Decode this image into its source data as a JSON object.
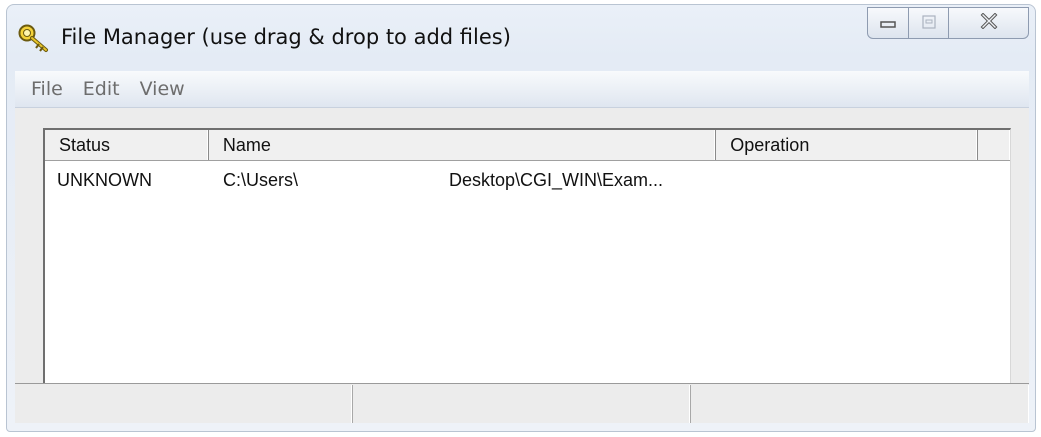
{
  "window": {
    "title": "File Manager (use drag & drop to add files)",
    "app_icon": "key-magnifier-icon",
    "controls": {
      "minimize": "minimize-icon",
      "maximize": "maximize-icon",
      "close": "close-icon"
    }
  },
  "menu": {
    "items": [
      {
        "label": "File"
      },
      {
        "label": "Edit"
      },
      {
        "label": "View"
      }
    ]
  },
  "file_list": {
    "columns": [
      {
        "label": "Status"
      },
      {
        "label": "Name"
      },
      {
        "label": "Operation"
      },
      {
        "label": ""
      }
    ],
    "rows": [
      {
        "status": "UNKNOWN",
        "name_prefix": "C:\\Users\\",
        "name_suffix": "Desktop\\CGI_WIN\\Exam...",
        "operation": ""
      }
    ]
  },
  "statusbar": {
    "panes": [
      {
        "text": ""
      },
      {
        "text": ""
      },
      {
        "text": ""
      }
    ]
  },
  "colors": {
    "titlebar": "#eaf0f8",
    "menu_text": "#6d6d6d",
    "list_bg": "#ffffff",
    "dialog_bg": "#ececec"
  }
}
